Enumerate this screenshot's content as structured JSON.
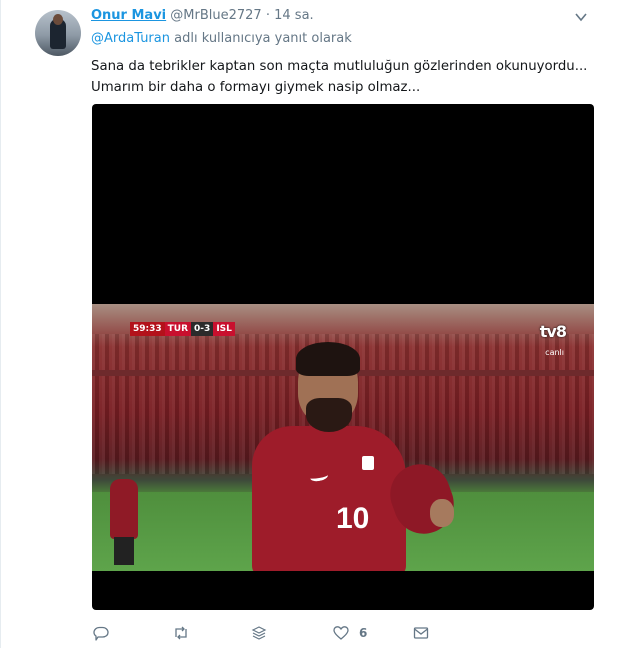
{
  "tweet": {
    "author_name": "Onur Mavi",
    "handle": "@MrBlue2727",
    "separator": "·",
    "time": "14 sa.",
    "reply_to_handle": "@ArdaTuran",
    "reply_to_suffix": " adlı kullanıcıya yanıt olarak",
    "text_lines": [
      "Sana da tebrikler kaptan son maçta mutluluğun gözlerinden okunuyordu...",
      "Umarım bir daha o formayı giymek nasip olmaz..."
    ]
  },
  "media": {
    "scoreboard": {
      "clock": "59:33",
      "home": "TUR",
      "score": "0-3",
      "away": "ISL"
    },
    "channel_logo": "tv8",
    "channel_sub": "canlı",
    "jersey_number": "10"
  },
  "actions": {
    "reply_icon": "reply-icon",
    "retweet_icon": "retweet-icon",
    "stack_icon": "stack-icon",
    "like_icon": "heart-icon",
    "like_count": "6",
    "message_icon": "envelope-icon"
  },
  "colors": {
    "accent": "#1b95e0",
    "muted": "#657786",
    "text": "#14171a"
  }
}
